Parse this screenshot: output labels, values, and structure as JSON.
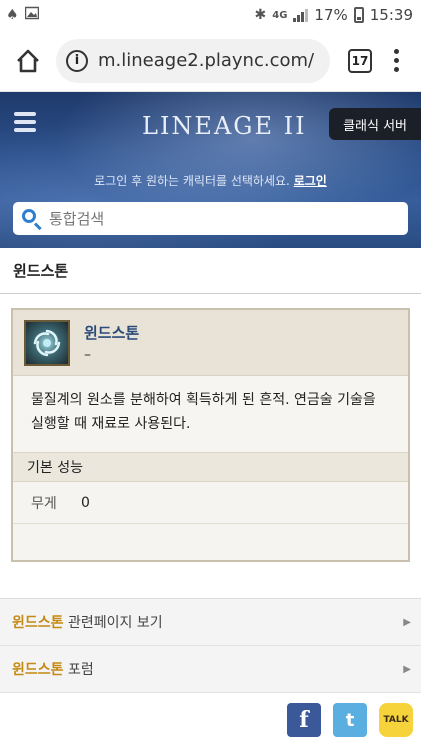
{
  "status_bar": {
    "battery": "17%",
    "time": "15:39",
    "network": "4G"
  },
  "browser": {
    "url": "m.lineage2.plaync.com/",
    "tab_count": "17"
  },
  "header": {
    "logo": "LINEAGE II",
    "classic_server_label": "클래식 서버",
    "login_message": "로그인 후 원하는 캐릭터를 선택하세요.",
    "login_link": "로그인",
    "search_placeholder": "통합검색"
  },
  "page": {
    "title": "윈드스톤"
  },
  "item": {
    "name": "윈드스톤",
    "subtitle": "–",
    "description": "물질계의 원소를 분해하여 획득하게 된 흔적. 연금술 기술을 실행할 때 재료로 사용된다.",
    "stats_header": "기본 성능",
    "stats": [
      {
        "label": "무게",
        "value": "0"
      }
    ]
  },
  "links": [
    {
      "highlight": "윈드스톤",
      "text": " 관련페이지 보기"
    },
    {
      "highlight": "윈드스톤",
      "text": " 포럼"
    }
  ],
  "share": {
    "facebook": "f",
    "twitter": "t",
    "kakaotalk": "TALK"
  }
}
